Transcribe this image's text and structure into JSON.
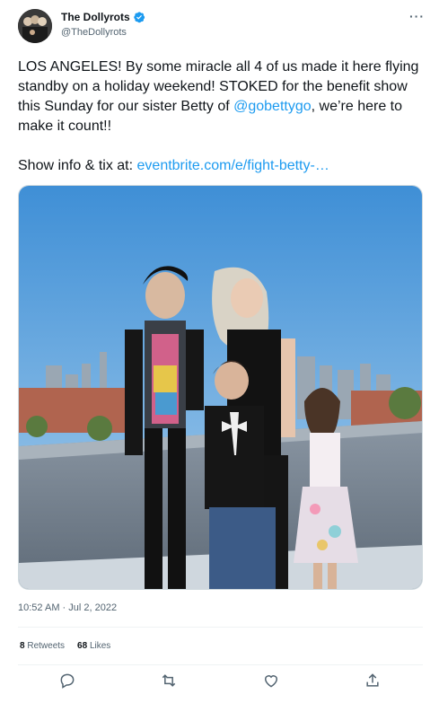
{
  "author": {
    "display_name": "The Dollyrots",
    "handle": "@TheDollyrots",
    "verified": true
  },
  "more_label": "···",
  "tweet": {
    "text_before_mention": "LOS ANGELES! By some miracle all 4 of us made it here flying standby on a holiday weekend! STOKED for the benefit show this Sunday for our sister Betty of ",
    "mention": "@gobettygo",
    "text_after_mention": ", we’re here to make it count!!",
    "show_info_label": "Show info & tix at: ",
    "link_text": "eventbrite.com/e/fight-betty-…"
  },
  "timestamp": "10:52 AM · Jul 2, 2022",
  "stats": {
    "retweets_count": "8",
    "retweets_label": "Retweets",
    "likes_count": "68",
    "likes_label": "Likes"
  },
  "icons": {
    "reply": "reply-icon",
    "retweet": "retweet-icon",
    "like": "heart-icon",
    "share": "share-icon"
  },
  "colors": {
    "link": "#1d9bf0",
    "verified": "#1d9bf0",
    "secondary_text": "#536471",
    "divider": "#eff3f4"
  }
}
